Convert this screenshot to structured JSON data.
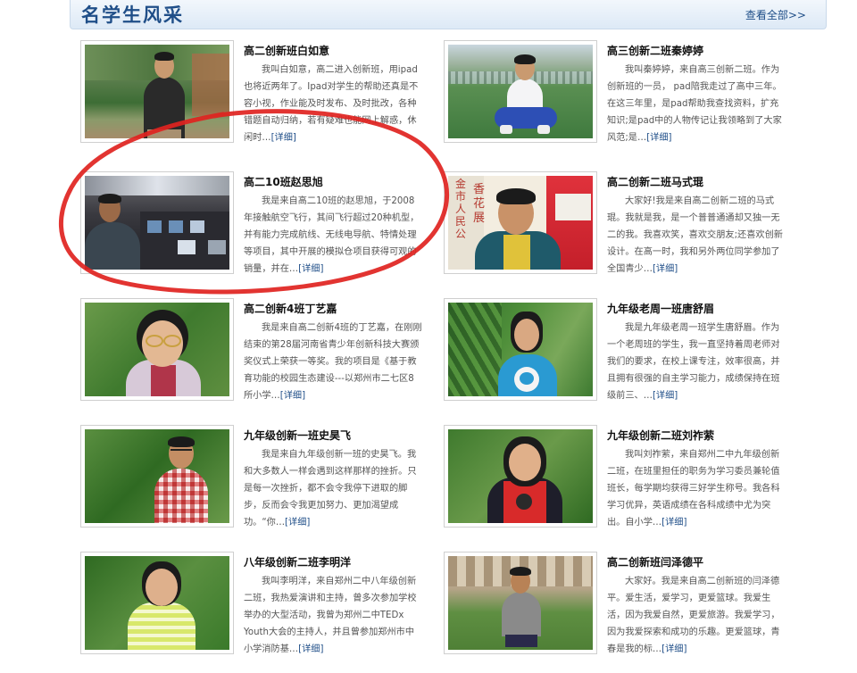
{
  "section": {
    "title": "名学生风采",
    "more_label": "查看全部>>"
  },
  "colors": {
    "accent": "#1f4e88",
    "annotation": "#e0231f"
  },
  "students": [
    {
      "name": "高二创新班白如意",
      "desc": "我叫白如意，高二进入创新班，用ipad也将近两年了。Ipad对学生的帮助还真是不容小视，作业能及时发布、及时批改，各种错题自动归纳，若有疑难也能网上解惑，休闲时…",
      "more": "[详细]"
    },
    {
      "name": "高三创新二班秦婷婷",
      "desc": "我叫秦婷婷，来自高三创新二班。作为创新班的一员， pad陪我走过了高中三年。在这三年里，是pad帮助我查找资料，扩充知识;是pad中的人物传记让我领略到了大家风范;是…",
      "more": "[详细]"
    },
    {
      "name": "高二10班赵思旭",
      "desc": "我是来自高二10班的赵思旭，于2008年接触航空飞行，其间飞行超过20种机型，并有能力完成航线、无线电导航、特情处理等项目，其中开展的模拟仓项目获得可观的销量，并在…",
      "more": "[详细]"
    },
    {
      "name": "高二创新二班马式琨",
      "desc": "大家好!我是来自高二创新二班的马式琨。我就是我，是一个普普通通却又独一无二的我。我喜欢笑，喜欢交朋友;还喜欢创新设计。在高一时，我和另外两位同学参加了全国青少…",
      "more": "[详细]"
    },
    {
      "name": "高二创新4班丁艺嘉",
      "desc": "我是来自高二创新4班的丁艺嘉，在刚刚结束的第28届河南省青少年创新科技大赛颁奖仪式上荣获一等奖。我的项目是《基于教育功能的校园生态建设---以郑州市二七区8所小学…",
      "more": "[详细]"
    },
    {
      "name": "九年级老周一班唐舒眉",
      "desc": "我是九年级老周一班学生唐舒眉。作为一个老周班的学生，我一直坚持着周老师对我们的要求，在校上课专注，效率很高，并且拥有很强的自主学习能力，成绩保持在班级前三、…",
      "more": "[详细]"
    },
    {
      "name": "九年级创新一班史昊飞",
      "desc": "我是来自九年级创新一班的史昊飞。我和大多数人一样会遇到这样那样的挫折。只是每一次挫折，都不会令我停下进取的脚步，反而会令我更加努力、更加渴望成功。“你…",
      "more": "[详细]"
    },
    {
      "name": "九年级创新二班刘祚萦",
      "desc": "我叫刘祚萦，来自郑州二中九年级创新二班，在班里担任的职务为学习委员兼轮值班长，每学期均获得三好学生称号。我各科学习优异，英语成绩在各科成绩中尤为突出。自小学…",
      "more": "[详细]"
    },
    {
      "name": "八年级创新二班李明洋",
      "desc": "我叫李明洋，来自郑州二中八年级创新二班，我热爱演讲和主持，曾多次参加学校举办的大型活动，我曾为郑州二中TEDx Youth大会的主持人，并且曾参加郑州市中小学消防基…",
      "more": "[详细]"
    },
    {
      "name": "高二创新班闫泽德平",
      "desc": "大家好。我是来自高二创新班的闫泽德平。爱生活，爱学习，更爱篮球。我爱生活，因为我爱自然，更爱旅游。我爱学习，因为我爱探索和成功的乐趣。更爱篮球，青春是我的标…",
      "more": "[详细]"
    }
  ]
}
